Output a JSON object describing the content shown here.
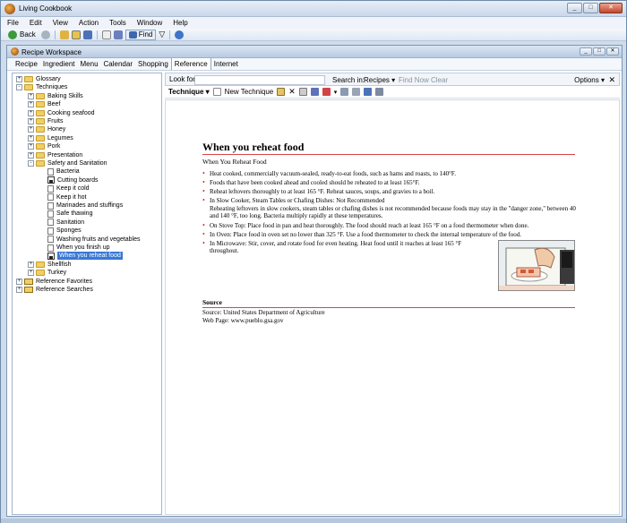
{
  "app": {
    "title": "Living Cookbook"
  },
  "menubar": [
    "File",
    "Edit",
    "View",
    "Action",
    "Tools",
    "Window",
    "Help"
  ],
  "toolbar": {
    "back_label": "Back",
    "find_label": "Find"
  },
  "workspace": {
    "title": "Recipe Workspace",
    "tabs": [
      "Recipe",
      "Ingredient",
      "Menu",
      "Calendar",
      "Shopping",
      "Reference",
      "Internet"
    ],
    "active_tab": "Reference"
  },
  "search": {
    "look_for_label": "Look for:",
    "look_for_value": "",
    "search_in_label": "Search in:",
    "search_in_value": "Recipes",
    "find_now": "Find Now",
    "clear": "Clear",
    "options": "Options"
  },
  "content_toolbar": {
    "technique_label": "Technique",
    "new_technique": "New Technique"
  },
  "tree": {
    "items": [
      {
        "label": "Glossary",
        "indent": 0,
        "kind": "folder",
        "exp": "+"
      },
      {
        "label": "Techniques",
        "indent": 0,
        "kind": "folder",
        "exp": "-"
      },
      {
        "label": "Baking Skills",
        "indent": 1,
        "kind": "folder",
        "exp": "+"
      },
      {
        "label": "Beef",
        "indent": 1,
        "kind": "folder",
        "exp": "+"
      },
      {
        "label": "Cooking seafood",
        "indent": 1,
        "kind": "folder",
        "exp": "+"
      },
      {
        "label": "Fruits",
        "indent": 1,
        "kind": "folder",
        "exp": "+"
      },
      {
        "label": "Honey",
        "indent": 1,
        "kind": "folder",
        "exp": "+"
      },
      {
        "label": "Legumes",
        "indent": 1,
        "kind": "folder",
        "exp": "+"
      },
      {
        "label": "Pork",
        "indent": 1,
        "kind": "folder",
        "exp": "+"
      },
      {
        "label": "Presentation",
        "indent": 1,
        "kind": "folder",
        "exp": "+"
      },
      {
        "label": "Safety and Sanitation",
        "indent": 1,
        "kind": "folder",
        "exp": "-"
      },
      {
        "label": "Bacteria",
        "indent": 2,
        "kind": "doc"
      },
      {
        "label": "Cutting boards",
        "indent": 2,
        "kind": "img"
      },
      {
        "label": "Keep it cold",
        "indent": 2,
        "kind": "doc"
      },
      {
        "label": "Keep it hot",
        "indent": 2,
        "kind": "doc"
      },
      {
        "label": "Marinades and stuffings",
        "indent": 2,
        "kind": "doc"
      },
      {
        "label": "Safe thawing",
        "indent": 2,
        "kind": "doc"
      },
      {
        "label": "Sanitation",
        "indent": 2,
        "kind": "doc"
      },
      {
        "label": "Sponges",
        "indent": 2,
        "kind": "doc"
      },
      {
        "label": "Washing fruits and vegetables",
        "indent": 2,
        "kind": "doc"
      },
      {
        "label": "When you finish up",
        "indent": 2,
        "kind": "doc"
      },
      {
        "label": "When you reheat food",
        "indent": 2,
        "kind": "img",
        "selected": true
      },
      {
        "label": "Shellfish",
        "indent": 1,
        "kind": "folder",
        "exp": "+"
      },
      {
        "label": "Turkey",
        "indent": 1,
        "kind": "folder",
        "exp": "+"
      },
      {
        "label": "Reference Favorites",
        "indent": 0,
        "kind": "rf",
        "exp": "+"
      },
      {
        "label": "Reference Searches",
        "indent": 0,
        "kind": "rf",
        "exp": "+"
      }
    ]
  },
  "article": {
    "title": "When you reheat food",
    "subtitle": "When You Reheat Food",
    "bullets": [
      "Heat cooked, commercially vacuum-sealed, ready-to-eat foods, such as hams and roasts, to 140°F.",
      "Foods that have been cooked ahead and cooled should be reheated to at least 165°F.",
      "Reheat leftovers thoroughly to at least 165 °F. Reheat sauces, soups, and gravies to a boil.",
      "In Slow Cooker, Steam Tables or Chafing Dishes: Not Recommended\nReheating leftovers in slow cookers, steam tables or chafing dishes is not recommended because foods may stay in the \"danger zone,\" between 40 and 140 °F, too long. Bacteria multiply rapidly at these temperatures.",
      "On Stove Top: Place food in pan and heat thoroughly. The food should reach at least 165 °F on a food thermometer when done.",
      "In Oven: Place food in oven set no lower than 325 °F. Use a food thermometer to check the internal temperature of the food.",
      "In Microwave: Stir, cover, and rotate food for even heating. Heat food until it reaches at least 165 °F throughout."
    ],
    "source_heading": "Source",
    "source_line": "Source: United States Department of Agriculture",
    "web_line": "Web Page: www.pueblo.gsa.gov"
  }
}
